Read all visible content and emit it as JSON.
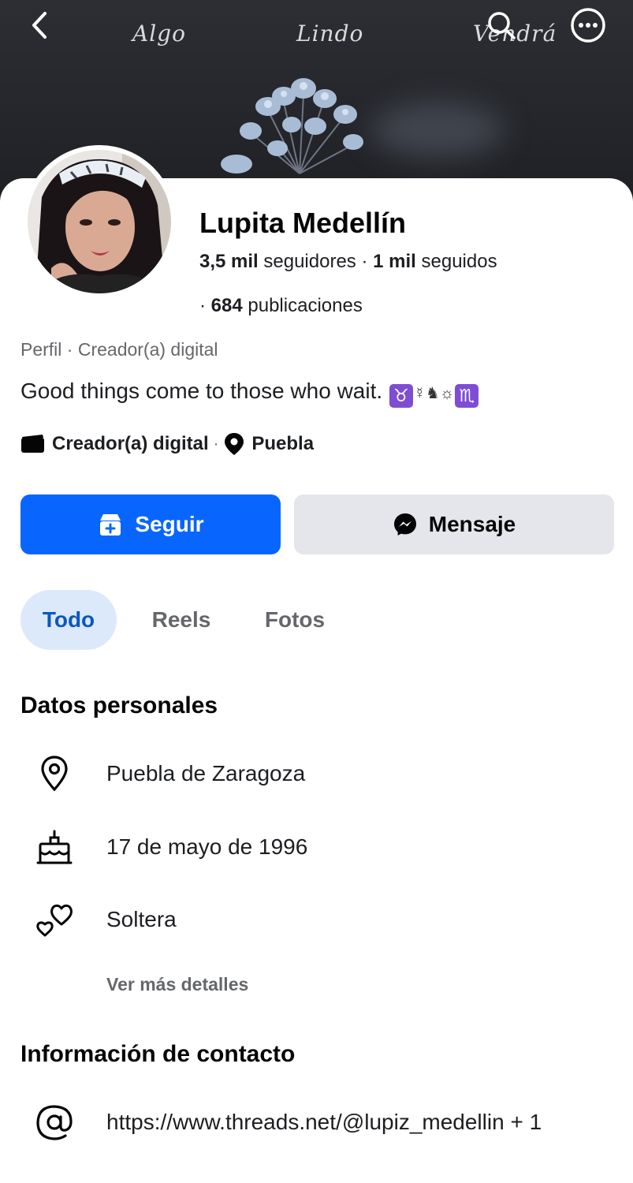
{
  "cover": {
    "words": [
      "Algo",
      "Lindo",
      "Vendrá"
    ]
  },
  "nav": {
    "back_icon": "chevron-left-icon",
    "search_icon": "search-icon",
    "more_icon": "more-dots-icon"
  },
  "profile": {
    "name": "Lupita Medellín",
    "followers_count": "3,5 mil",
    "followers_label": " seguidores",
    "sep": " · ",
    "following_count": "1 mil",
    "following_label": " seguidos",
    "posts_prefix": "· ",
    "posts_count": "684",
    "posts_label": " publicaciones",
    "meta": "Perfil · Creador(a) digital",
    "bio_text": "Good things come to those who wait. ",
    "bio_sign1": "♉",
    "bio_symbols": "☿♞☼",
    "bio_sign2": "♏",
    "category": "Creador(a) digital",
    "location": "Puebla"
  },
  "actions": {
    "follow_label": "Seguir",
    "message_label": "Mensaje"
  },
  "tabs": [
    {
      "label": "Todo",
      "active": true
    },
    {
      "label": "Reels",
      "active": false
    },
    {
      "label": "Fotos",
      "active": false
    }
  ],
  "personal": {
    "title": "Datos personales",
    "items": [
      {
        "icon": "location-pin-icon",
        "text": "Puebla de Zaragoza"
      },
      {
        "icon": "birthday-cake-icon",
        "text": "17 de mayo de 1996"
      },
      {
        "icon": "hearts-icon",
        "text": "Soltera"
      }
    ],
    "more_label": "Ver más detalles"
  },
  "contact": {
    "title": "Información de contacto",
    "items": [
      {
        "icon": "at-sign-icon",
        "text": "https://www.threads.net/@lupiz_medellin + 1"
      }
    ]
  },
  "colors": {
    "accent": "#0866ff",
    "tab_active_bg": "#dce9fb",
    "tab_active_text": "#0a58c2",
    "secondary_button": "#e4e6eb",
    "muted_text": "#65676b"
  }
}
